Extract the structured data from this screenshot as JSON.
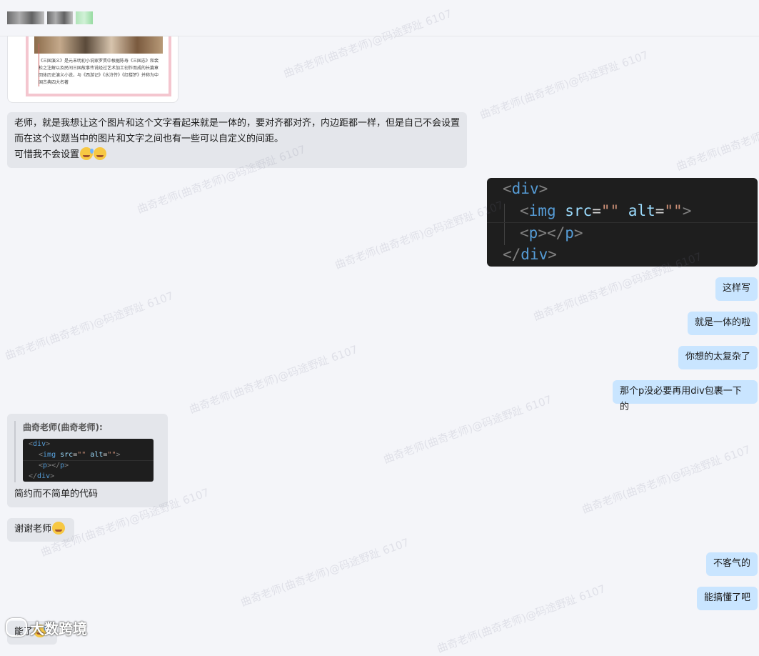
{
  "header": {
    "contact_name": ""
  },
  "image_card": {
    "caption": "《三国演义》是元末明初小说家罗贯中根据陈寿《三国志》和裴松之注解以及民间三国故事传说经过艺术加工创作而成的长篇章回体历史演义小说，与《西游记》《水浒传》《红楼梦》并称为中国古典四大名著"
  },
  "messages": {
    "m1_line1": "老师，就是我想让这个图片和这个文字看起来就是一体的，要对齐都对齐，内边距都一样，但是自己不会设置",
    "m1_line2": "而在这个议题当中的图片和文字之间也有一些可以自定义的间距。",
    "m1_line3": "可惜我不会设置",
    "m2": "这样写",
    "m3": "就是一体的啦",
    "m4": "你想的太复杂了",
    "m5": "那个p没必要再用div包裹一下的",
    "quote_author": "曲奇老师(曲奇老师):",
    "quote_reply": "简约而不简单的代码",
    "m6": "谢谢老师",
    "m7": "不客气的",
    "m8": "能搞懂了吧",
    "m9": "能了"
  },
  "code_block": {
    "open_div": "div",
    "img_tag": "img",
    "src_attr": "src",
    "alt_attr": "alt",
    "empty_str": "\"\"",
    "p_tag": "p",
    "close_div": "div"
  },
  "watermark_text": "曲奇老师(曲奇老师)@码途野趾 6107",
  "logo_text": "大数跨境",
  "colors": {
    "incoming_bubble": "#e4e6eb",
    "outgoing_bubble": "#c9e5ff",
    "code_bg": "#1e1e1e"
  }
}
